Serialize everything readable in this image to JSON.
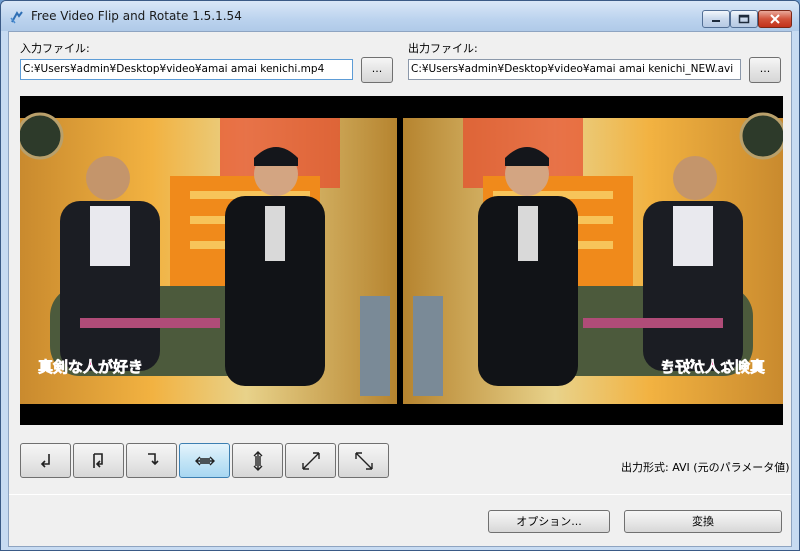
{
  "window": {
    "title": "Free Video Flip and Rotate 1.5.1.54"
  },
  "input": {
    "label": "入力ファイル:",
    "path": "C:¥Users¥admin¥Desktop¥video¥amai amai kenichi.mp4",
    "browse_label": "..."
  },
  "output": {
    "label": "出力ファイル:",
    "path": "C:¥Users¥admin¥Desktop¥video¥amai amai kenichi_NEW.avi",
    "browse_label": "..."
  },
  "preview": {
    "caption_left": "真剣な人が好き",
    "caption_right": "真剣な人が好き"
  },
  "transform_buttons": [
    {
      "name": "rotate-left",
      "icon": "rotate-left-icon",
      "active": false
    },
    {
      "name": "rotate-180",
      "icon": "rotate-180-icon",
      "active": false
    },
    {
      "name": "rotate-right",
      "icon": "rotate-right-icon",
      "active": false
    },
    {
      "name": "flip-horizontal",
      "icon": "flip-horizontal-icon",
      "active": true
    },
    {
      "name": "flip-vertical",
      "icon": "flip-vertical-icon",
      "active": false
    },
    {
      "name": "transpose",
      "icon": "diagonal-ne-icon",
      "active": false
    },
    {
      "name": "transverse",
      "icon": "diagonal-nw-icon",
      "active": false
    }
  ],
  "output_format": "出力形式: AVI (元のパラメータ値)",
  "buttons": {
    "options_label": "オプション...",
    "convert_label": "変換"
  },
  "colors": {
    "titlebar": "#bcd3ee",
    "active_button": "#c4e5f6",
    "caption_text": "#ff3399"
  }
}
